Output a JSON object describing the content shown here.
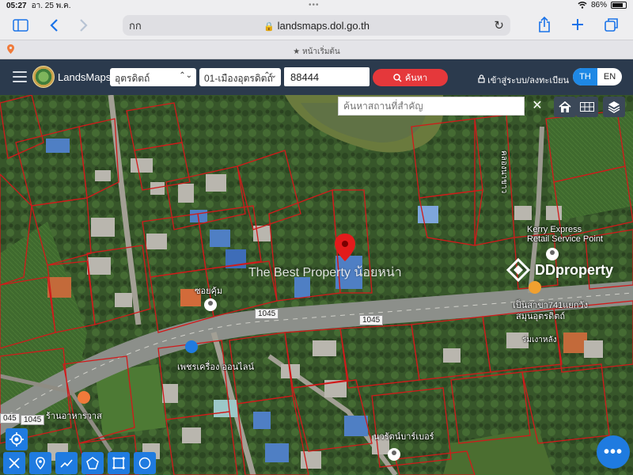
{
  "status_bar": {
    "time": "05:27",
    "date": "อา. 25 พ.ค.",
    "battery": "86%"
  },
  "browser": {
    "aa": "กก",
    "url": "landsmaps.dol.go.th",
    "bookmark": "หน้าเริ่มต้น"
  },
  "app": {
    "brand": "LandsMaps",
    "province": "อุตรดิตถ์",
    "district": "01-เมืองอุตรดิตถ์",
    "parcel_number": "88444",
    "search_label": "ค้นหา",
    "login_label": "เข้าสู่ระบบ/ลงทะเบียน",
    "lang_th": "TH",
    "lang_en": "EN"
  },
  "map": {
    "place_search_placeholder": "ค้นหาสถานที่สำคัญ",
    "watermark": "The Best Property น้อยหน่า",
    "ddproperty": "DDproperty",
    "fab": "•••",
    "labels": {
      "kerry": "Kerry Express\nRetail Service Point",
      "station": "เป็นสาขา741แยกวัง",
      "station2": "สมุนอุตรดิตถ์",
      "soi": "ซอยคุ้ม",
      "road_1045_a": "1045",
      "road_1045_b": "1045",
      "road_1045_c": "1045",
      "road_1045_d": "045",
      "shop": "เพชรเครื่อง ออนไลน์",
      "restaurant": "ร้านอาหารวาส",
      "barber": "นวรัตน์บาร์เบอร์",
      "vertical": "คลองนาขาว",
      "misc": "ร่มเงาหลัง"
    }
  },
  "colors": {
    "appbar": "#2b3a4d",
    "accent": "#1f7be0",
    "search": "#e5383b",
    "parcel_lines": "#d11a1a"
  }
}
